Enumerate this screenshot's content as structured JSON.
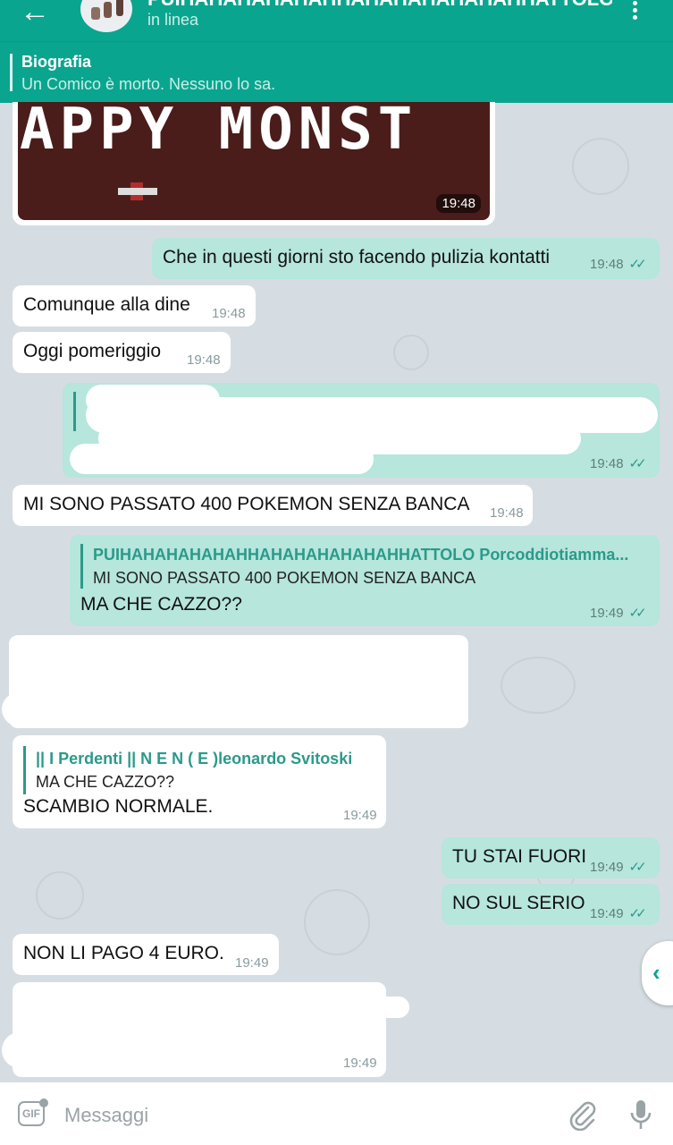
{
  "header": {
    "title": "PUIHAHAHAHAHAHHAHAHAHAHAHAHHATTOLO Porcoddiotiamma...",
    "status": "in linea",
    "back_icon": "arrow-left-icon",
    "menu_icon": "more-vertical-icon"
  },
  "pinned": {
    "title": "Biografia",
    "text": "Un Comico è morto. Nessuno lo sa."
  },
  "image_message": {
    "caption_art": "APPY MONST",
    "time": "19:48"
  },
  "messages": [
    {
      "dir": "out",
      "text": "Che in questi giorni sto facendo pulizia kontatti",
      "time": "19:48",
      "ticks": "✓✓"
    },
    {
      "dir": "in",
      "text": "Comunque alla dine",
      "time": "19:48"
    },
    {
      "dir": "in",
      "text": "Oggi pomeriggio",
      "time": "19:48"
    },
    {
      "dir": "out",
      "text": "",
      "time": "19:48",
      "ticks": "✓✓",
      "redacted": true
    },
    {
      "dir": "in",
      "text": "MI SONO PASSATO 400 POKEMON SENZA BANCA",
      "time": "19:48"
    },
    {
      "dir": "out",
      "reply_name": "PUIHAHAHAHAHAHHAHAHAHAHAHAHHATTOLO Porcoddiotiamma...",
      "reply_text": "MI SONO PASSATO 400 POKEMON SENZA BANCA",
      "text": "MA CHE CAZZO??",
      "time": "19:49",
      "ticks": "✓✓"
    },
    {
      "dir": "in",
      "text": "",
      "time": "",
      "redacted": true
    },
    {
      "dir": "in",
      "reply_name": "|| I Perdenti || N  E  N ( E )leonardo Svitoski",
      "reply_text": "MA CHE CAZZO??",
      "text": "SCAMBIO NORMALE.",
      "time": "19:49"
    },
    {
      "dir": "out",
      "text": "TU STAI FUORI",
      "time": "19:49",
      "ticks": "✓✓"
    },
    {
      "dir": "out",
      "text": "NO SUL SERIO",
      "time": "19:49",
      "ticks": "✓✓"
    },
    {
      "dir": "in",
      "text": "NON LI PAGO 4 EURO.",
      "time": "19:49"
    },
    {
      "dir": "in",
      "text": "",
      "time": "19:49",
      "redacted": true
    }
  ],
  "input": {
    "placeholder": "Messaggi",
    "gif_label": "GIF",
    "attach_icon": "paperclip-icon",
    "mic_icon": "microphone-icon"
  },
  "side_button": {
    "label": "‹"
  },
  "colors": {
    "header": "#0aa58f",
    "outgoing_bubble": "#b6e6dc",
    "incoming_bubble": "#ffffff",
    "background": "#d6dde2",
    "accent": "#2b9a8a"
  }
}
